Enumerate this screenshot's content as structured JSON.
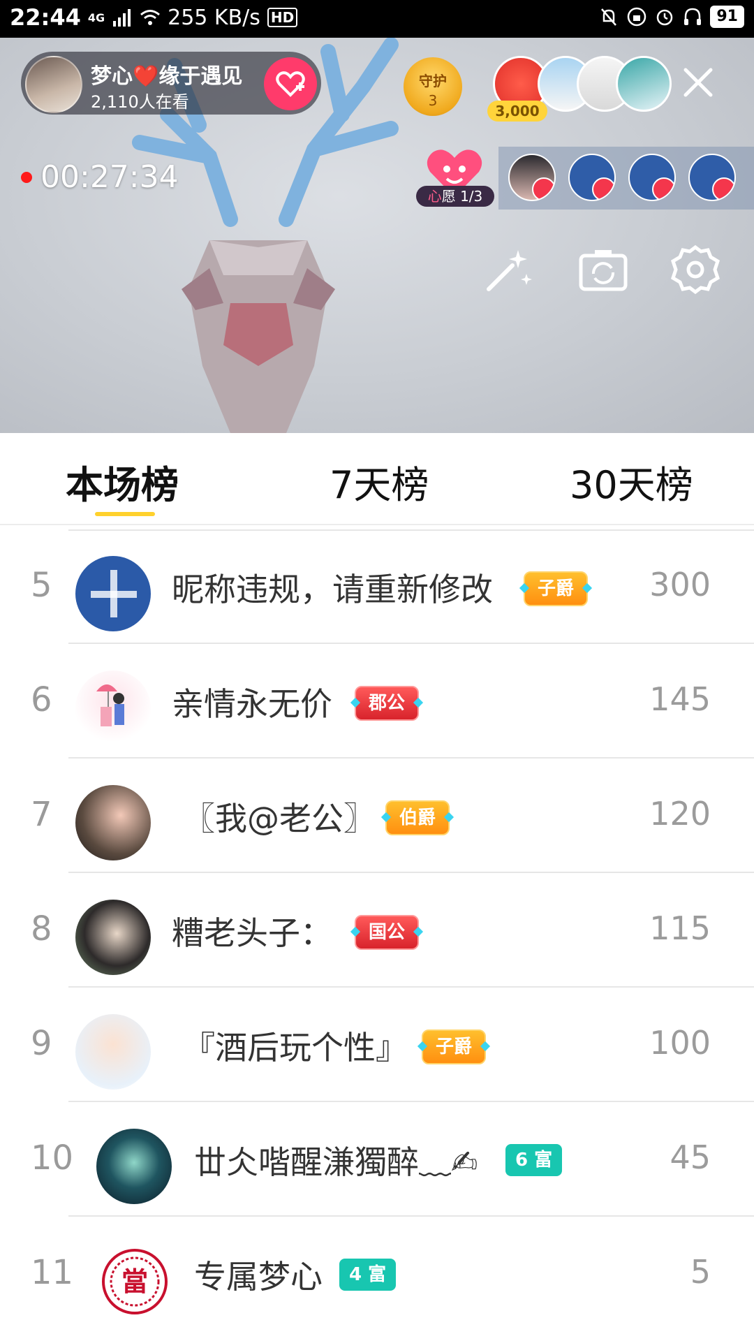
{
  "status_bar": {
    "time": "22:44",
    "network": "4G",
    "speed": "255 KB/s",
    "hd": "HD",
    "battery": "91"
  },
  "live": {
    "host_name": "梦心❤️缘于遇见",
    "viewers": "2,110人在看",
    "guard_label": "守护",
    "guard_count": "3",
    "coins": "3,000",
    "record_time": "00:27:34",
    "wish_prefix": "心",
    "wish_text": "愿 1/3"
  },
  "tabs": [
    "本场榜",
    "7天榜",
    "30天榜"
  ],
  "ranking": [
    {
      "rank": "5",
      "name": "昵称违规，请重新修改",
      "badge": "子爵",
      "badge_style": "orange",
      "score": "300"
    },
    {
      "rank": "6",
      "name": "亲情永无价",
      "badge": "郡公",
      "badge_style": "red",
      "score": "145"
    },
    {
      "rank": "7",
      "name": "〖我@老公〗",
      "badge": "伯爵",
      "badge_style": "orange",
      "score": "120"
    },
    {
      "rank": "8",
      "name": "糟老头子：",
      "badge": "国公",
      "badge_style": "red",
      "score": "115"
    },
    {
      "rank": "9",
      "name": "『酒后玩个性』",
      "badge": "子爵",
      "badge_style": "orange",
      "score": "100"
    },
    {
      "rank": "10",
      "name": "丗仌喈醒溓獨醉﹏✍",
      "badge": "6 富",
      "badge_style": "teal",
      "score": "45"
    },
    {
      "rank": "11",
      "name": "专属梦心",
      "badge": "4 富",
      "badge_style": "teal",
      "score": "5"
    }
  ],
  "colors": {
    "accent_yellow": "#ffd12c",
    "follow_pink": "#ff3b6b",
    "noble_orange": "#ff8f10",
    "noble_red": "#d8232c",
    "wealth_teal": "#18c6b0"
  }
}
